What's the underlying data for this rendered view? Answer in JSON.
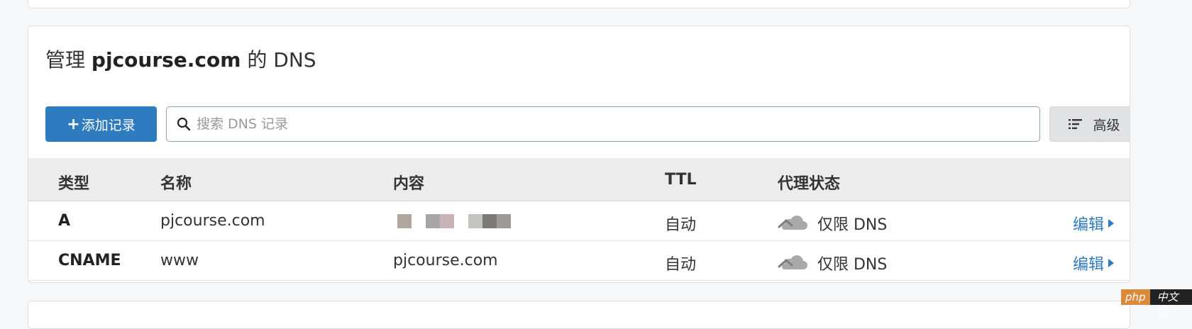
{
  "title": {
    "prefix": "管理",
    "domain": "pjcourse.com",
    "suffix": "的 DNS"
  },
  "toolbar": {
    "add_label": "添加记录",
    "search_placeholder": "搜索 DNS 记录",
    "search_value": "",
    "advanced_label": "高级"
  },
  "table": {
    "headers": {
      "type": "类型",
      "name": "名称",
      "content": "内容",
      "ttl": "TTL",
      "proxy": "代理状态"
    },
    "rows": [
      {
        "type": "A",
        "name": "pjcourse.com",
        "content": "",
        "content_redacted": true,
        "ttl": "自动",
        "proxy": "仅限 DNS",
        "edit": "编辑"
      },
      {
        "type": "CNAME",
        "name": "www",
        "content": "pjcourse.com",
        "content_redacted": false,
        "ttl": "自动",
        "proxy": "仅限 DNS",
        "edit": "编辑"
      }
    ]
  },
  "watermark": {
    "left": "php",
    "right": "中文网"
  },
  "colors": {
    "accent": "#2f7bbf",
    "header_bg": "#ececec",
    "cloud_gray": "#9a9a9a"
  }
}
